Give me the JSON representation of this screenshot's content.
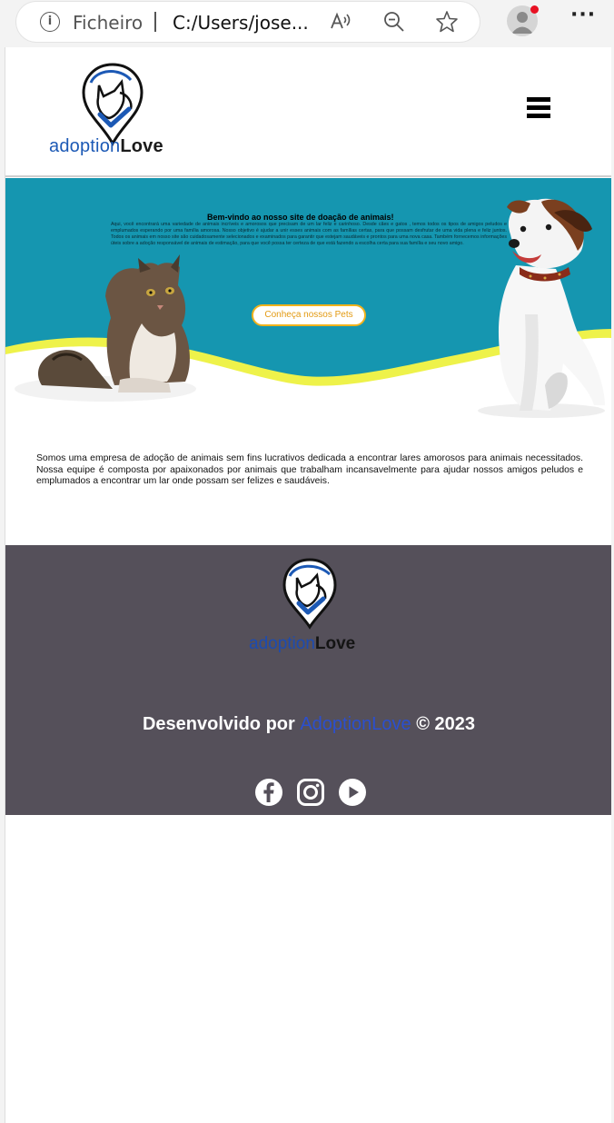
{
  "browser": {
    "protocol_label": "Ficheiro",
    "url": "C:/Users/jose...",
    "icons": [
      "info-icon",
      "read-aloud-icon",
      "zoom-out-icon",
      "favorite-star-icon",
      "profile-avatar-icon",
      "more-menu-icon"
    ]
  },
  "header": {
    "brand_part1": "adoption",
    "brand_part2": "Love",
    "menu_icon": "hamburger-menu-icon"
  },
  "hero": {
    "title": "Bem-vindo ao nosso site de doação de animais!",
    "text": "Aqui, você encontrará uma variedade de animais incríveis e amorosos que precisam de um lar feliz e carinhoso. Desde cães e gatos , temos todos os tipos de amigos peludos e emplumados esperando por uma família amorosa. Nosso objetivo é ajudar a unir esses animais com as famílias certas, para que possam desfrutar de uma vida plena e feliz juntos. Todos os animais em nosso site são cuidadosamente selecionados e examinados para garantir que estejam saudáveis e prontos para uma nova casa. Também fornecemos informações úteis sobre a adoção responsável de animais de estimação, para que você possa ter certeza de que está fazendo a escolha certa para sua família e seu novo amigo.",
    "cta_label": "Conheça nossos Pets"
  },
  "about": {
    "text": "Somos uma empresa de adoção de animais sem fins lucrativos dedicada a encontrar lares amorosos para animais necessitados. Nossa equipe é composta por apaixonados por animais que trabalham incansavelmente para ajudar nossos amigos peludos e emplumados a encontrar um lar onde possam ser felizes e saudáveis."
  },
  "footer": {
    "brand_part1": "adoption",
    "brand_part2": "Love",
    "credits_prefix": "Desenvolvido por",
    "credits_brand": "AdoptionLove",
    "credits_suffix": "© 2023",
    "social": [
      "facebook-icon",
      "instagram-icon",
      "youtube-icon"
    ]
  },
  "colors": {
    "brand_blue": "#1c59b5",
    "hero_teal": "#1596b0",
    "wave_yellow": "#eef24a",
    "cta_orange": "#f0b21c",
    "footer_bg": "#55505a"
  }
}
